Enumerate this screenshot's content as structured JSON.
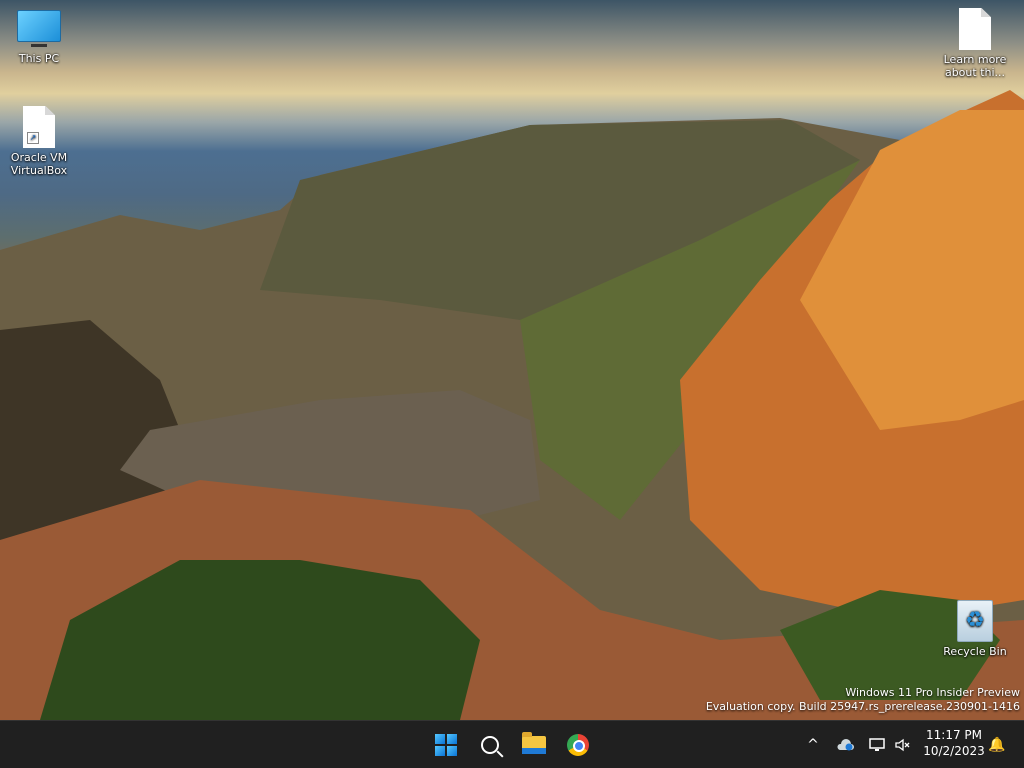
{
  "desktop": {
    "icons": [
      {
        "label": "This PC",
        "icon": "monitor-icon"
      },
      {
        "label": "Oracle VM VirtualBox",
        "icon": "shortcut-file-icon"
      },
      {
        "label": "Learn more about thi...",
        "icon": "file-icon"
      },
      {
        "label": "Recycle Bin",
        "icon": "recycle-bin-icon"
      }
    ],
    "watermark": {
      "line1": "Windows 11 Pro Insider Preview",
      "line2": "Evaluation copy. Build 25947.rs_prerelease.230901-1416"
    }
  },
  "taskbar": {
    "apps": [
      {
        "name": "Start",
        "icon": "windows-start-icon"
      },
      {
        "name": "Search",
        "icon": "search-icon"
      },
      {
        "name": "File Explorer",
        "icon": "folder-icon"
      },
      {
        "name": "Google Chrome",
        "icon": "chrome-icon"
      }
    ],
    "tray": {
      "overflow_glyph": "^",
      "time": "11:17 PM",
      "date": "10/2/2023",
      "notification_glyph": "🔔"
    }
  },
  "colors": {
    "taskbar_bg": "#202020",
    "accent": "#0a74d6"
  }
}
